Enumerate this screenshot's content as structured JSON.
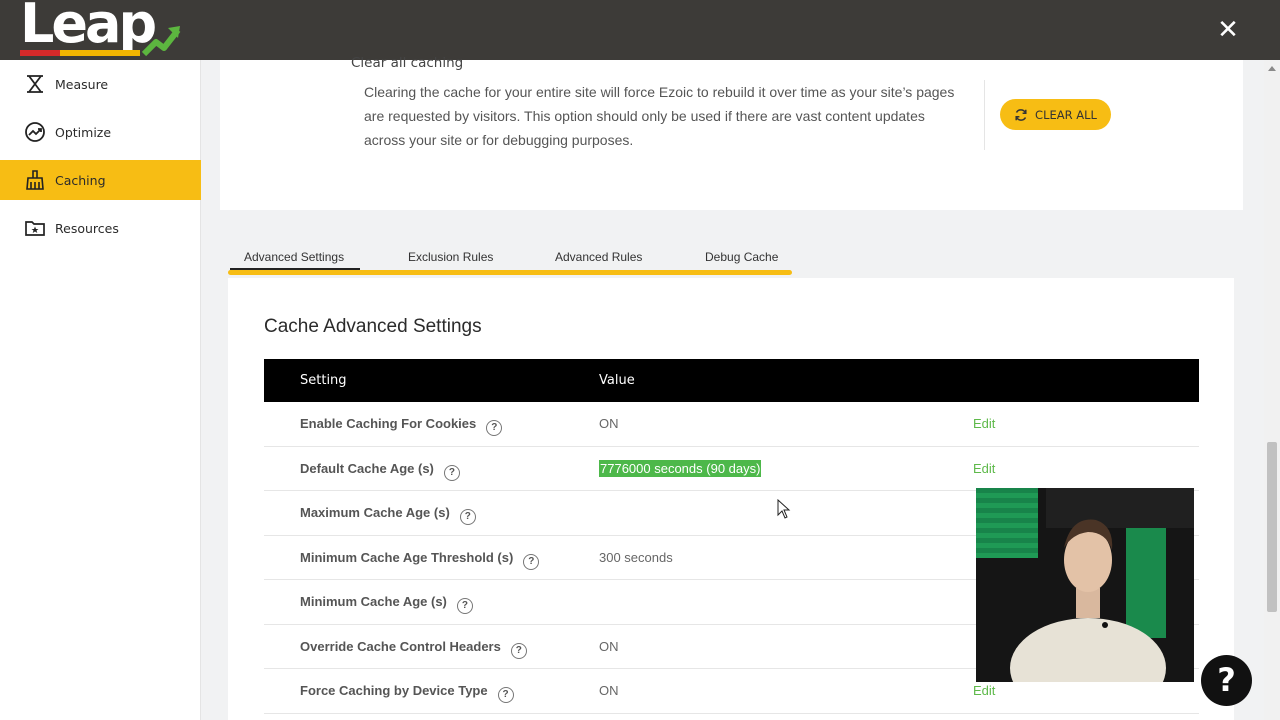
{
  "brand": {
    "logo_text": "Leap",
    "accent": "#f7bd14",
    "dark_bar": "#3d3b38"
  },
  "sidebar": {
    "items": [
      {
        "label": "Measure",
        "icon": "measure-icon",
        "active": false
      },
      {
        "label": "Optimize",
        "icon": "optimize-icon",
        "active": false
      },
      {
        "label": "Caching",
        "icon": "broom-icon",
        "active": true
      },
      {
        "label": "Resources",
        "icon": "folder-star-icon",
        "active": false
      }
    ]
  },
  "clear_section": {
    "title": "Clear all caching",
    "description": "Clearing the cache for your entire site will force Ezoic to rebuild it over time as your site’s pages are requested by visitors. This option should only be used if there are vast content updates across your site or for debugging purposes.",
    "button_label": "CLEAR ALL"
  },
  "tabs": [
    {
      "label": "Advanced Settings",
      "active": true
    },
    {
      "label": "Exclusion Rules",
      "active": false
    },
    {
      "label": "Advanced Rules",
      "active": false
    },
    {
      "label": "Debug Cache",
      "active": false
    }
  ],
  "settings": {
    "title": "Cache Advanced Settings",
    "columns": {
      "setting": "Setting",
      "value": "Value"
    },
    "rows": [
      {
        "label": "Enable Caching For Cookies",
        "value": "ON",
        "edit": "Edit",
        "highlight": false
      },
      {
        "label": "Default Cache Age (s)",
        "value": "7776000 seconds (90 days)",
        "edit": "Edit",
        "highlight": true
      },
      {
        "label": "Maximum Cache Age (s)",
        "value": "",
        "edit": "",
        "highlight": false
      },
      {
        "label": "Minimum Cache Age Threshold (s)",
        "value": "300 seconds",
        "edit": "",
        "highlight": false
      },
      {
        "label": "Minimum Cache Age (s)",
        "value": "",
        "edit": "",
        "highlight": false
      },
      {
        "label": "Override Cache Control Headers",
        "value": "ON",
        "edit": "",
        "highlight": false
      },
      {
        "label": "Force Caching by Device Type",
        "value": "ON",
        "edit": "Edit",
        "highlight": false
      }
    ]
  },
  "help_bubble": "?",
  "close_glyph": "✕"
}
